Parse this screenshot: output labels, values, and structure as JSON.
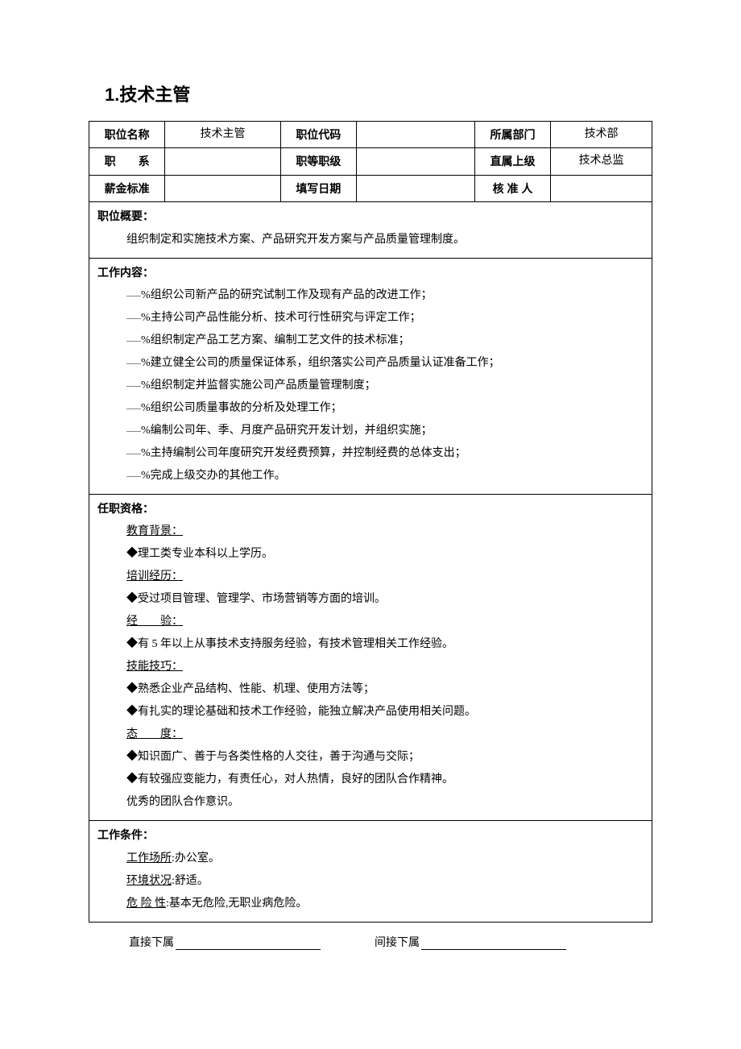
{
  "title": "1.技术主管",
  "header": {
    "r1": {
      "c1": "职位名称",
      "c2": "技术主管",
      "c3": "职位代码",
      "c4": "",
      "c5": "所属部门",
      "c6": "技术部"
    },
    "r2": {
      "c1": "职　　系",
      "c2": "",
      "c3": "职等职级",
      "c4": "",
      "c5": "直属上级",
      "c6": "技术总监"
    },
    "r3": {
      "c1": "薪金标准",
      "c2": "",
      "c3": "填写日期",
      "c4": "",
      "c5": "核 准 人",
      "c6": ""
    }
  },
  "overview": {
    "title": "职位概要：",
    "body": "组织制定和实施技术方案、产品研究开发方案与产品质量管理制度。"
  },
  "work": {
    "title": "工作内容：",
    "items": [
      "%组织公司新产品的研究试制工作及现有产品的改进工作；",
      "%主持公司产品性能分析、技术可行性研究与评定工作；",
      "%组织制定产品工艺方案、编制工艺文件的技术标准；",
      "%建立健全公司的质量保证体系，组织落实公司产品质量认证准备工作；",
      "%组织制定并监督实施公司产品质量管理制度；",
      "%组织公司质量事故的分析及处理工作；",
      "%编制公司年、季、月度产品研究开发计划，并组织实施；",
      "%主持编制公司年度研究开发经费预算，并控制经费的总体支出；",
      "%完成上级交办的其他工作。"
    ]
  },
  "qual": {
    "title": "任职资格：",
    "edu_label": "教育背景：",
    "edu_item": "◆理工类专业本科以上学历。",
    "train_label": "培训经历：",
    "train_item": "◆受过项目管理、管理学、市场营销等方面的培训。",
    "exp_label_a": "经",
    "exp_label_b": "验：",
    "exp_item": "◆有 5 年以上从事技术支持服务经验，有技术管理相关工作经验。",
    "skill_label": "技能技巧：",
    "skill_items": [
      "◆熟悉企业产品结构、性能、机理、使用方法等；",
      "◆有扎实的理论基础和技术工作经验，能独立解决产品使用相关问题。"
    ],
    "att_label_a": "态",
    "att_label_b": "度：",
    "att_items": [
      "◆知识面广、善于与各类性格的人交往，善于沟通与交际；",
      "◆有较强应变能力，有责任心，对人热情，良好的团队合作精神。"
    ],
    "att_extra": "优秀的团队合作意识。"
  },
  "cond": {
    "title": "工作条件：",
    "place_label": "工作场所",
    "place_val": ":办公室。",
    "env_label": "环境状况",
    "env_val": ":舒适。",
    "danger_label": "危 险 性",
    "danger_val": ":基本无危险,无职业病危险。"
  },
  "footer": {
    "direct": "直接下属",
    "indirect": "间接下属"
  }
}
